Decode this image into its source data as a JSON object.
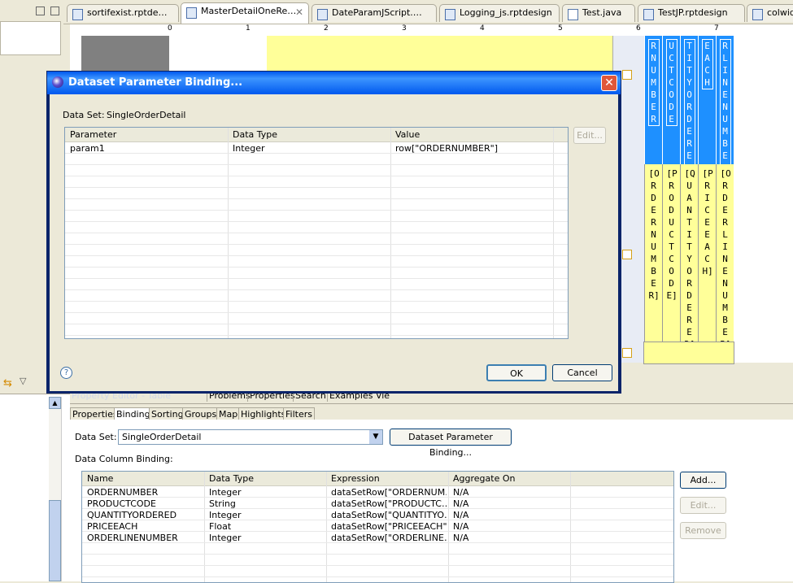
{
  "editor_tabs": [
    {
      "label": "sortifexist.rptde…",
      "active": false
    },
    {
      "label": "MasterDetailOneRe…",
      "active": true
    },
    {
      "label": "DateParamJScript.…",
      "active": false
    },
    {
      "label": "Logging_js.rptdesign",
      "active": false
    },
    {
      "label": "Test.java",
      "active": false
    },
    {
      "label": "TestJP.rptdesign",
      "active": false
    },
    {
      "label": "colwidt",
      "active": false
    }
  ],
  "ruler_numbers": [
    "0",
    "1",
    "2",
    "3",
    "4",
    "5",
    "6",
    "7"
  ],
  "report_columns": {
    "headers": [
      "RNUMBER",
      "UCTCODE",
      "TITYORDERED",
      "EACH",
      "RLINENUMBER"
    ],
    "fields": [
      "[ORDERNUMBER]",
      "[PRODUCTCODE]",
      "[QUANTITYORDERED]",
      "[PRICEEACH]",
      "[ORDERLINENUMBER]"
    ]
  },
  "dialog": {
    "title": "Dataset Parameter Binding...",
    "dataset_label": "Data Set:",
    "dataset_value": "SingleOrderDetail",
    "columns": [
      "Parameter",
      "Data Type",
      "Value"
    ],
    "rows": [
      {
        "parameter": "param1",
        "data_type": "Integer",
        "value": "row[\"ORDERNUMBER\"]"
      }
    ],
    "edit_button": "Edit...",
    "ok_button": "OK",
    "cancel_button": "Cancel",
    "help_icon": "?"
  },
  "bottom_tabs": [
    "Property Editor - Table",
    "Problems",
    "Properties",
    "Search",
    "Examples View"
  ],
  "property_tabs": [
    "Properties",
    "Binding",
    "Sorting",
    "Groups",
    "Map",
    "Highlights",
    "Filters"
  ],
  "active_property_tab": "Binding",
  "binding": {
    "dataset_label": "Data Set:",
    "dataset_value": "SingleOrderDetail",
    "param_binding_button": "Dataset Parameter Binding...",
    "column_binding_label": "Data Column Binding:",
    "columns": [
      "Name",
      "Data Type",
      "Expression",
      "Aggregate On"
    ],
    "rows": [
      {
        "name": "ORDERNUMBER",
        "type": "Integer",
        "expr": "dataSetRow[\"ORDERNUM…",
        "agg": "N/A"
      },
      {
        "name": "PRODUCTCODE",
        "type": "String",
        "expr": "dataSetRow[\"PRODUCTC…",
        "agg": "N/A"
      },
      {
        "name": "QUANTITYORDERED",
        "type": "Integer",
        "expr": "dataSetRow[\"QUANTITYO…",
        "agg": "N/A"
      },
      {
        "name": "PRICEEACH",
        "type": "Float",
        "expr": "dataSetRow[\"PRICEEACH\"]",
        "agg": "N/A"
      },
      {
        "name": "ORDERLINENUMBER",
        "type": "Integer",
        "expr": "dataSetRow[\"ORDERLINE…",
        "agg": "N/A"
      }
    ],
    "add_button": "Add...",
    "edit_button": "Edit...",
    "remove_button": "Remove"
  },
  "colors": {
    "title_bar": "#0058ee",
    "blue_header": "#1e90ff",
    "yellow_cell": "#ffff99",
    "close_red": "#e0583a"
  }
}
